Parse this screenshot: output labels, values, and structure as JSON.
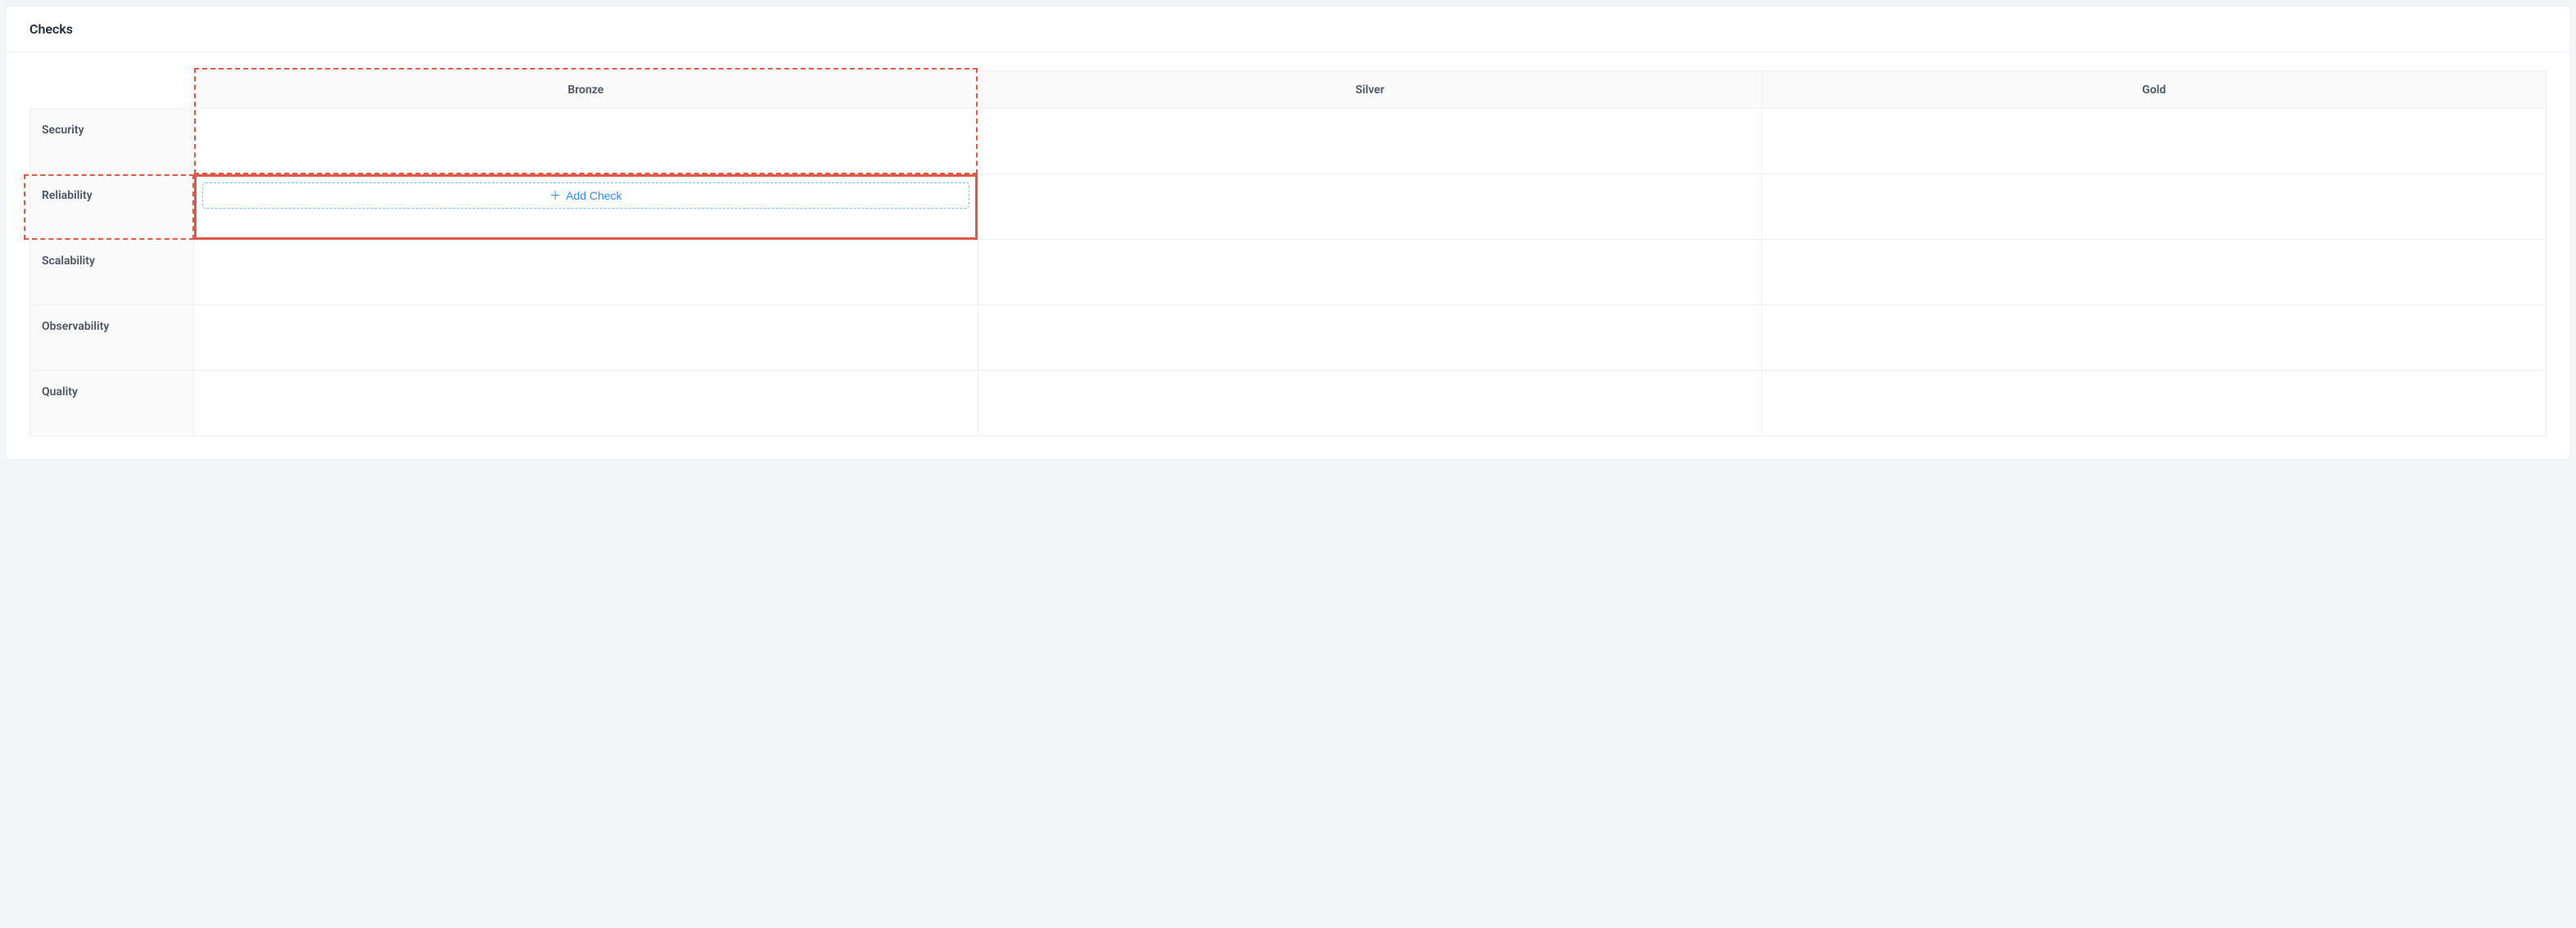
{
  "header": {
    "title": "Checks"
  },
  "columns": [
    "Bronze",
    "Silver",
    "Gold"
  ],
  "rows": [
    "Security",
    "Reliability",
    "Scalability",
    "Observability",
    "Quality"
  ],
  "addCheck": {
    "label": "Add Check"
  },
  "highlight": {
    "row": "Reliability",
    "col": "Bronze"
  }
}
